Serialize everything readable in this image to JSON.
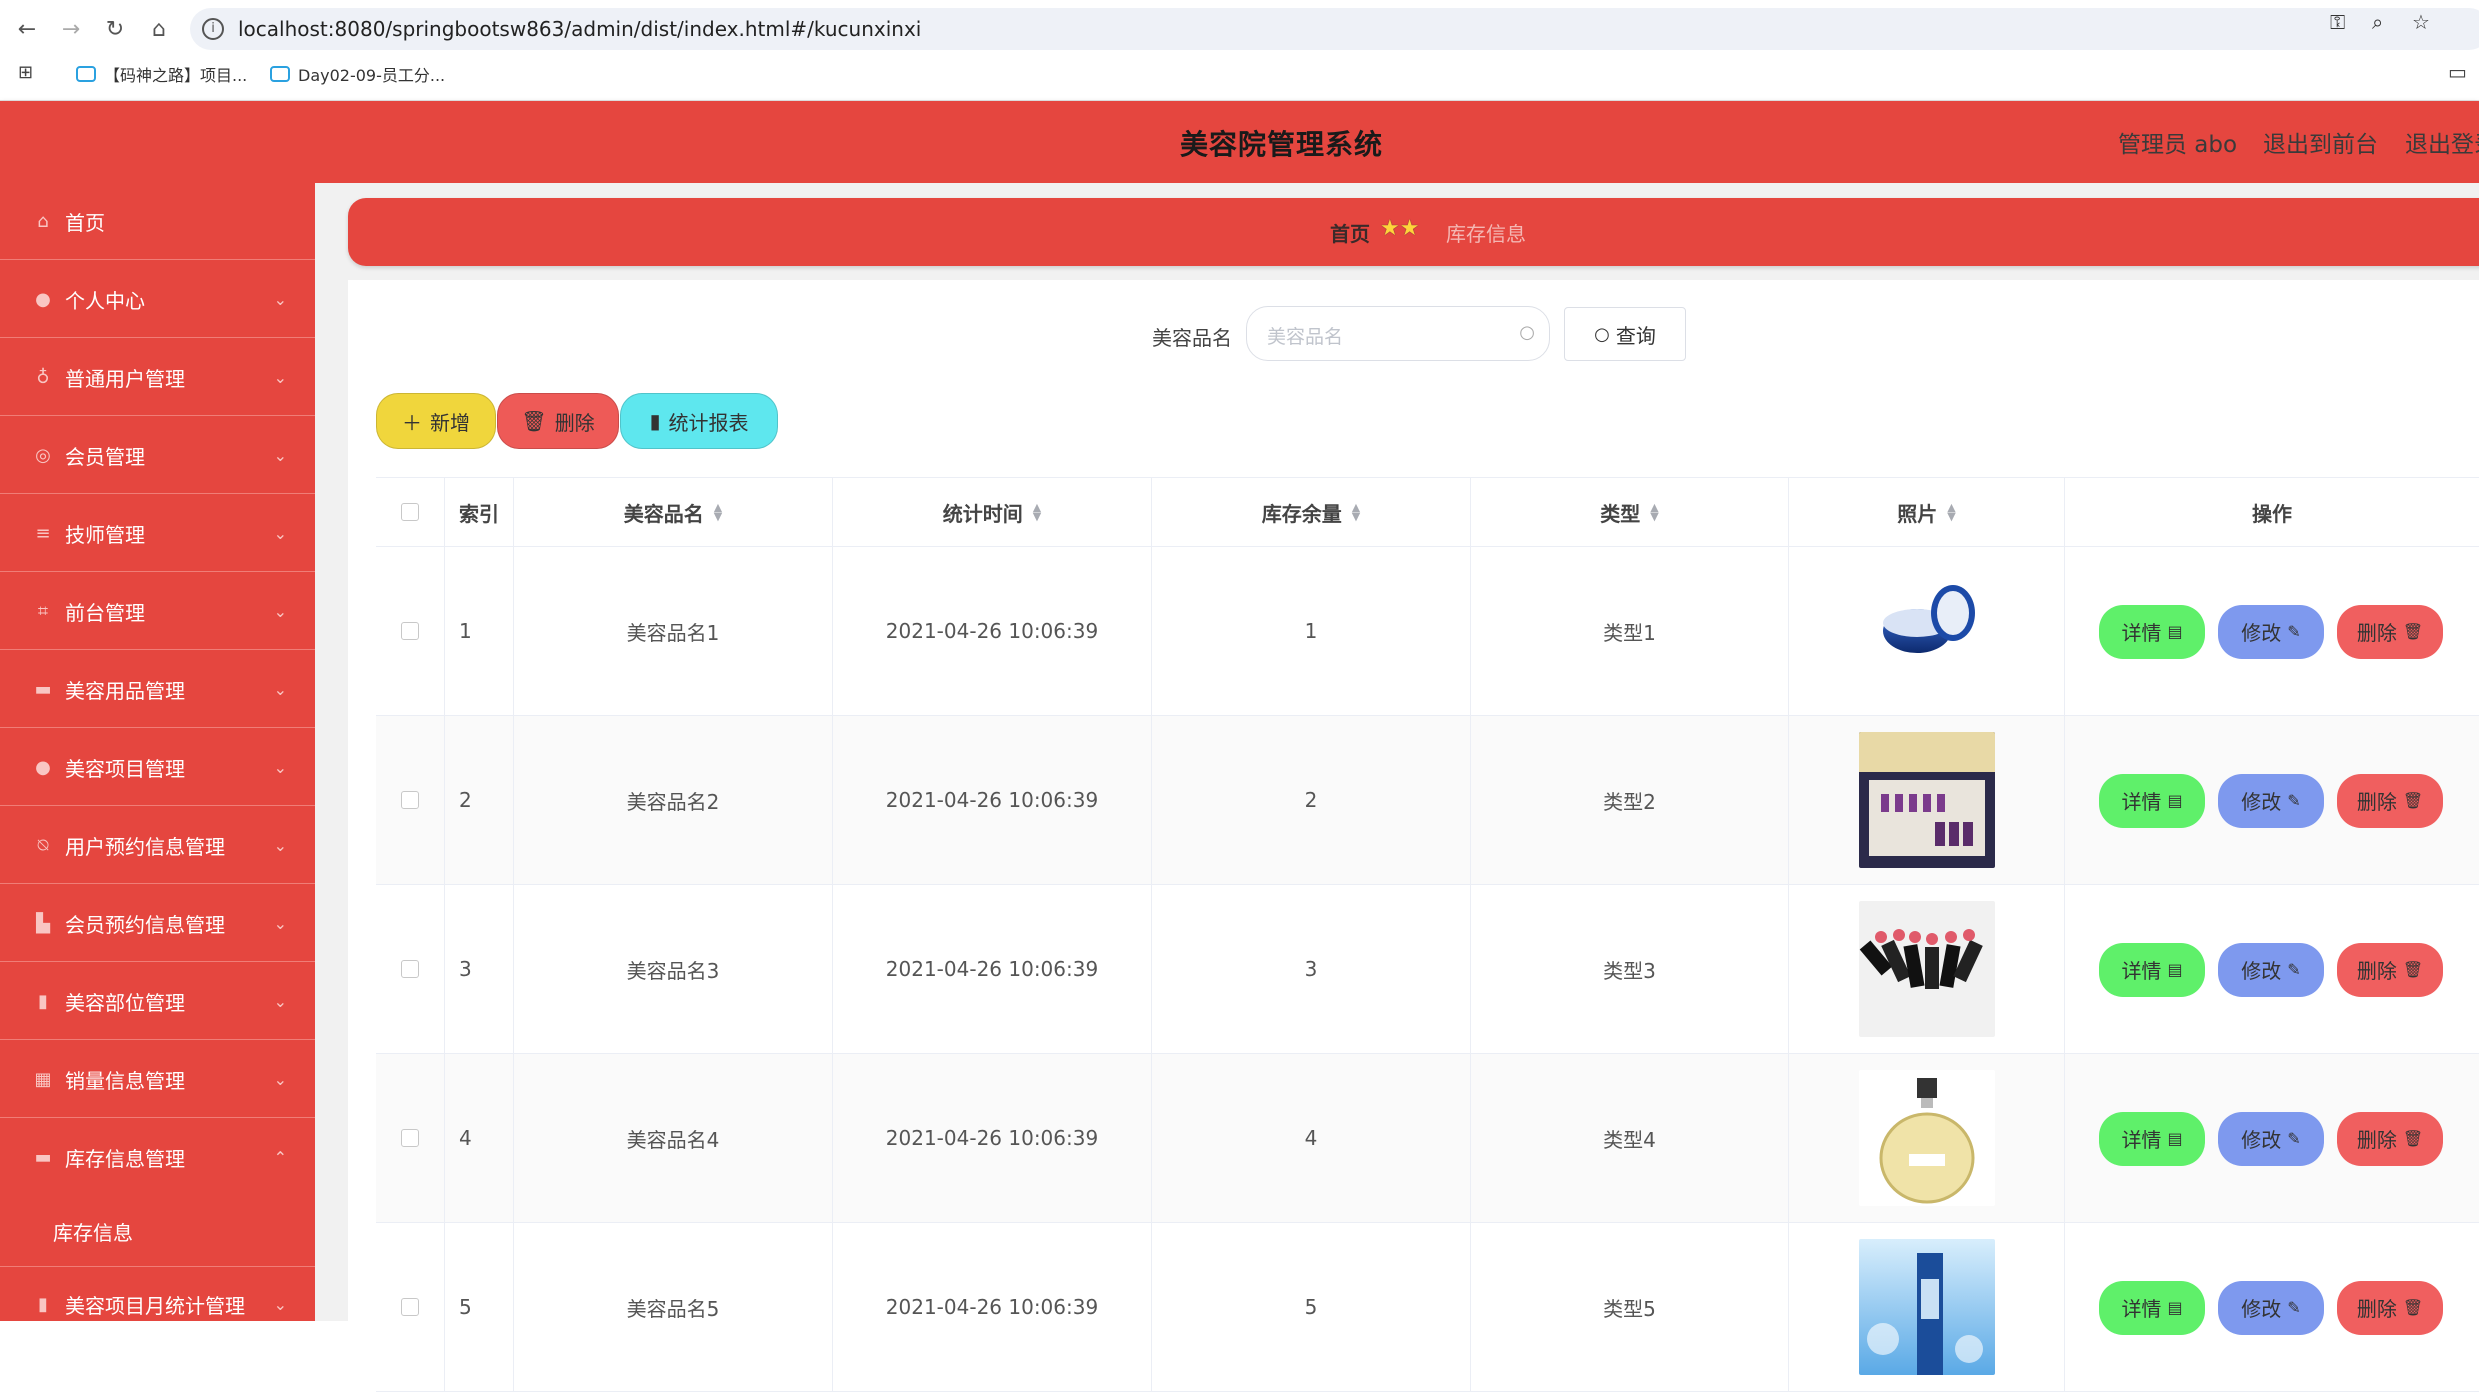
{
  "browser": {
    "url": "localhost:8080/springbootsw863/admin/dist/index.html#/kucunxinxi",
    "bookmarks": [
      "【码神之路】项目...",
      "Day02-09-员工分..."
    ]
  },
  "header": {
    "title": "美容院管理系统",
    "admin": "管理员 abo",
    "to_front": "退出到前台",
    "logout": "退出登录"
  },
  "sidebar": {
    "items": [
      {
        "label": "首页",
        "icon": "home-icon"
      },
      {
        "label": "个人中心",
        "icon": "user-icon"
      },
      {
        "label": "普通用户管理",
        "icon": "mic-icon"
      },
      {
        "label": "会员管理",
        "icon": "compass-icon"
      },
      {
        "label": "技师管理",
        "icon": "sliders-icon"
      },
      {
        "label": "前台管理",
        "icon": "crop-icon"
      },
      {
        "label": "美容用品管理",
        "icon": "monitor-icon"
      },
      {
        "label": "美容项目管理",
        "icon": "person-icon"
      },
      {
        "label": "用户预约信息管理",
        "icon": "bell-off-icon"
      },
      {
        "label": "会员预约信息管理",
        "icon": "stamp-icon"
      },
      {
        "label": "美容部位管理",
        "icon": "bar-chart-icon"
      },
      {
        "label": "销量信息管理",
        "icon": "grid-icon"
      },
      {
        "label": "库存信息管理",
        "icon": "monitor-icon"
      }
    ],
    "subitem": "库存信息",
    "last_item": "美容项目月统计管理"
  },
  "breadcrumb": {
    "home": "首页",
    "current": "库存信息"
  },
  "search": {
    "label": "美容品名",
    "placeholder": "美容品名",
    "button": "查询"
  },
  "toolbar": {
    "add": "新增",
    "delete": "删除",
    "report": "统计报表"
  },
  "table": {
    "columns": [
      "索引",
      "美容品名",
      "统计时间",
      "库存余量",
      "类型",
      "照片",
      "操作"
    ],
    "rows": [
      {
        "index": "1",
        "name": "美容品名1",
        "time": "2021-04-26 10:06:39",
        "stock": "1",
        "type": "类型1"
      },
      {
        "index": "2",
        "name": "美容品名2",
        "time": "2021-04-26 10:06:39",
        "stock": "2",
        "type": "类型2"
      },
      {
        "index": "3",
        "name": "美容品名3",
        "time": "2021-04-26 10:06:39",
        "stock": "3",
        "type": "类型3"
      },
      {
        "index": "4",
        "name": "美容品名4",
        "time": "2021-04-26 10:06:39",
        "stock": "4",
        "type": "类型4"
      },
      {
        "index": "5",
        "name": "美容品名5",
        "time": "2021-04-26 10:06:39",
        "stock": "5",
        "type": "类型5"
      }
    ],
    "actions": {
      "detail": "详情",
      "edit": "修改",
      "delete": "删除"
    }
  },
  "colors": {
    "primary": "#e5463f",
    "add_button": "#f0d63c",
    "delete_button": "#ee5a57",
    "report_button": "#5ee7ee",
    "detail_button": "#5ff06a",
    "edit_button": "#7e99ee",
    "row_delete_button": "#f05f5f"
  }
}
